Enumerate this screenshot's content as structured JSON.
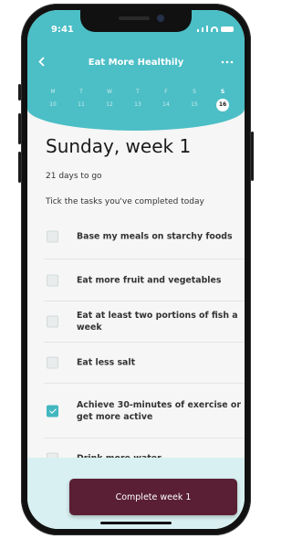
{
  "status": {
    "time": "9:41"
  },
  "header": {
    "back_icon": "chevron-left-icon",
    "title": "Eat More Healthily",
    "more_icon": "more-dots-icon"
  },
  "week": [
    {
      "letter": "M",
      "date": "10",
      "selected": false
    },
    {
      "letter": "T",
      "date": "11",
      "selected": false
    },
    {
      "letter": "W",
      "date": "12",
      "selected": false
    },
    {
      "letter": "T",
      "date": "13",
      "selected": false
    },
    {
      "letter": "F",
      "date": "14",
      "selected": false
    },
    {
      "letter": "S",
      "date": "15",
      "selected": false
    },
    {
      "letter": "S",
      "date": "16",
      "selected": true
    }
  ],
  "main": {
    "heading": "Sunday, week 1",
    "days_to_go": "21 days to go",
    "instruction": "Tick the tasks you've completed today"
  },
  "tasks": [
    {
      "label": "Base my meals on starchy foods",
      "checked": false
    },
    {
      "label": "Eat more fruit and vegetables",
      "checked": false
    },
    {
      "label": "Eat at least two portions of fish a week",
      "checked": false
    },
    {
      "label": "Eat less salt",
      "checked": false
    },
    {
      "label": "Achieve 30-minutes of exercise or get more active",
      "checked": true
    },
    {
      "label": "Drink more water",
      "checked": false
    }
  ],
  "footer": {
    "button_label": "Complete week 1"
  },
  "colors": {
    "header": "#4cbec6",
    "checkbox_checked": "#42b7c0",
    "cta": "#5a1f34",
    "footer": "#d8f0f1"
  }
}
